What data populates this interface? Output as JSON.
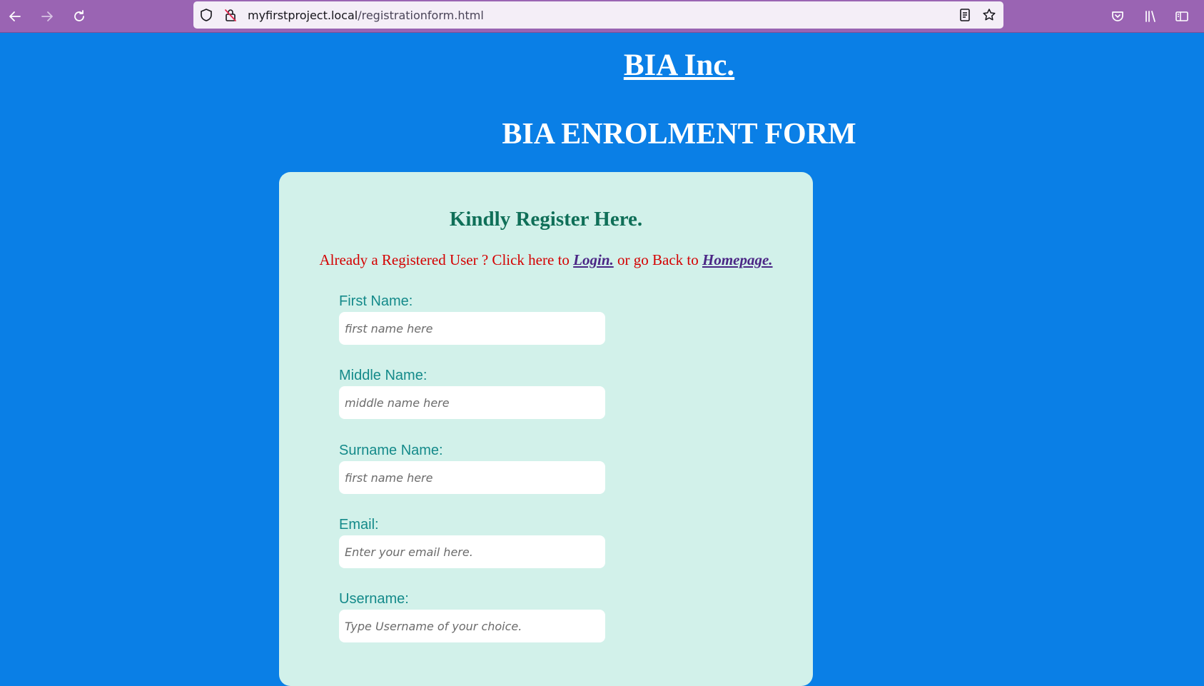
{
  "browser": {
    "url_host": "myfirstproject.local",
    "url_path": "/registrationform.html",
    "icons": [
      "back-arrow-icon",
      "forward-arrow-icon",
      "reload-icon",
      "shield-icon",
      "insecure-lock-icon",
      "reader-view-icon",
      "bookmark-star-icon",
      "pocket-icon",
      "library-icon",
      "sidebar-icon"
    ]
  },
  "page": {
    "company": "BIA Inc.",
    "form_title": "BIA ENROLMENT FORM"
  },
  "card": {
    "heading": "Kindly Register Here.",
    "login_prefix": "Already a Registered User ? Click here to ",
    "login_link": "Login.",
    "login_middle": " or go Back to ",
    "homepage_link": "Homepage."
  },
  "fields": [
    {
      "label": "First Name:",
      "placeholder": "first name here",
      "value": ""
    },
    {
      "label": "Middle Name:",
      "placeholder": "middle name here",
      "value": ""
    },
    {
      "label": "Surname Name:",
      "placeholder": "first name here",
      "value": ""
    },
    {
      "label": "Email:",
      "placeholder": "Enter your email here.",
      "value": ""
    },
    {
      "label": "Username:",
      "placeholder": "Type Username of your choice.",
      "value": ""
    }
  ],
  "colors": {
    "page_background": "#0a7fe6",
    "card_background": "#d2f1ea",
    "toolbar": "#9a64b3",
    "heading_green": "#0f6f58",
    "label_teal": "#148a8a",
    "link_text": "#d40000",
    "link_purple": "#4b2685"
  }
}
